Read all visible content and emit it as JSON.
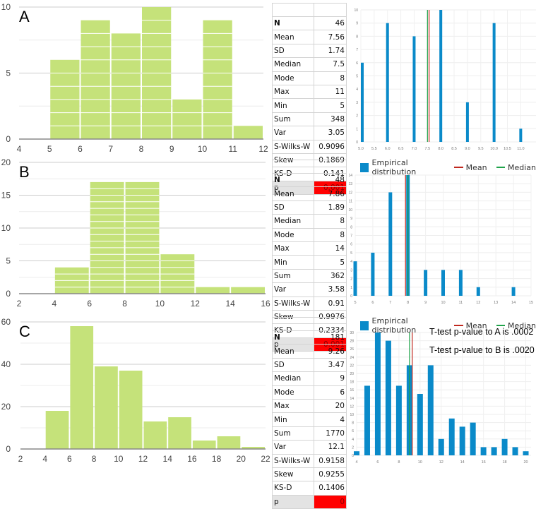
{
  "colors": {
    "histogram_fill": "#c5e27a",
    "empirical_bar": "#0a8ac9",
    "mean_line": "#c0281f",
    "median_line": "#1fa34a",
    "p_cell": "#ff0000",
    "p_text": "#8b0000"
  },
  "legend": {
    "empirical": "Empirical distribution",
    "mean": "Mean",
    "median": "Median"
  },
  "notes": {
    "ttest_a": "T-test p-value to A is .0002",
    "ttest_b": "T-test p-value to B is .0020"
  },
  "chart_data": [
    {
      "id": "A-histogram",
      "type": "bar",
      "title": "A",
      "bin_edges": [
        4,
        5,
        6,
        7,
        8,
        9,
        10,
        11,
        12
      ],
      "values": [
        0,
        6,
        9,
        8,
        10,
        3,
        9,
        1
      ],
      "xlim": [
        4,
        12
      ],
      "ylim": [
        0,
        10
      ],
      "xticks": [
        4,
        5,
        6,
        7,
        8,
        9,
        10,
        11,
        12
      ],
      "yticks": [
        0,
        5,
        10
      ],
      "grid": true
    },
    {
      "id": "A-empirical",
      "type": "bar",
      "x": [
        5,
        6,
        7,
        8,
        9,
        10,
        11
      ],
      "values": [
        6,
        9,
        8,
        10,
        3,
        9,
        1
      ],
      "mean": 7.56,
      "median": 7.5,
      "xlim": [
        5.0,
        11.6
      ],
      "ylim": [
        0,
        10
      ],
      "xticks": [
        "5.0",
        "5.5",
        "6.0",
        "6.5",
        "7.0",
        "7.5",
        "8.0",
        "8.5",
        "9.0",
        "9.5",
        "10.0",
        "10.5",
        "11.0"
      ],
      "yticks": [
        0,
        1,
        2,
        3,
        4,
        5,
        6,
        7,
        8,
        9,
        10
      ],
      "grid": true
    },
    {
      "id": "B-histogram",
      "type": "bar",
      "title": "B",
      "bin_edges": [
        2,
        4,
        6,
        8,
        10,
        12,
        14,
        16
      ],
      "values": [
        0,
        4,
        17,
        17,
        6,
        1,
        1
      ],
      "xlim": [
        2,
        16
      ],
      "ylim": [
        0,
        20
      ],
      "xticks": [
        2,
        4,
        6,
        8,
        10,
        12,
        14,
        16
      ],
      "yticks": [
        0,
        5,
        10,
        15,
        20
      ],
      "grid": true
    },
    {
      "id": "B-empirical",
      "type": "bar",
      "legend": "top",
      "x": [
        5,
        6,
        7,
        8,
        9,
        10,
        11,
        12,
        14
      ],
      "values": [
        4,
        5,
        12,
        14,
        3,
        3,
        3,
        1,
        1
      ],
      "mean": 7.86,
      "median": 8,
      "xlim": [
        5,
        15
      ],
      "ylim": [
        0,
        14
      ],
      "xticks": [
        5,
        6,
        7,
        8,
        9,
        10,
        11,
        12,
        13,
        14,
        15
      ],
      "yticks": [
        0,
        1,
        2,
        3,
        4,
        5,
        6,
        7,
        8,
        9,
        10,
        11,
        12,
        13,
        14
      ],
      "grid": true
    },
    {
      "id": "C-histogram",
      "type": "bar",
      "title": "C",
      "bin_edges": [
        2,
        4,
        6,
        8,
        10,
        12,
        14,
        16,
        18,
        20,
        22
      ],
      "values": [
        0,
        18,
        58,
        39,
        37,
        13,
        15,
        4,
        6,
        1
      ],
      "xlim": [
        2,
        22
      ],
      "ylim": [
        0,
        60
      ],
      "xticks": [
        2,
        4,
        6,
        8,
        10,
        12,
        14,
        16,
        18,
        20,
        22
      ],
      "yticks": [
        0,
        20,
        40,
        60
      ],
      "grid": true
    },
    {
      "id": "C-empirical",
      "type": "bar",
      "legend": "top",
      "x": [
        4,
        5,
        6,
        7,
        8,
        9,
        10,
        11,
        12,
        13,
        14,
        15,
        16,
        17,
        18,
        19,
        20
      ],
      "values": [
        1,
        17,
        30,
        28,
        17,
        22,
        15,
        22,
        4,
        9,
        7,
        8,
        2,
        2,
        4,
        2,
        1
      ],
      "mean": 9.26,
      "median": 9,
      "xlim": [
        4,
        20.5
      ],
      "ylim": [
        0,
        30
      ],
      "xticks": [
        4,
        6,
        8,
        10,
        12,
        14,
        16,
        18,
        20
      ],
      "yticks": [
        0,
        2,
        4,
        6,
        8,
        10,
        12,
        14,
        16,
        18,
        20,
        22,
        24,
        26,
        28,
        30
      ],
      "grid": true
    }
  ],
  "stats": [
    {
      "panel": "A",
      "rows": [
        {
          "key": "N",
          "value": "46"
        },
        {
          "key": "Mean",
          "value": "7.56"
        },
        {
          "key": "SD",
          "value": "1.74"
        },
        {
          "key": "Median",
          "value": "7.5"
        },
        {
          "key": "Mode",
          "value": "8"
        },
        {
          "key": "Max",
          "value": "11"
        },
        {
          "key": "Min",
          "value": "5"
        },
        {
          "key": "Sum",
          "value": "348"
        },
        {
          "key": "Var",
          "value": "3.05"
        },
        {
          "key": "S-Wilks-W",
          "value": "0.9096"
        },
        {
          "key": "Skew",
          "value": "0.1869"
        },
        {
          "key": "KS-D",
          "value": "0.141"
        },
        {
          "key": "p",
          "value": "0.001"
        }
      ]
    },
    {
      "panel": "B",
      "rows": [
        {
          "key": "N",
          "value": "48"
        },
        {
          "key": "Mean",
          "value": "7.86"
        },
        {
          "key": "SD",
          "value": "1.89"
        },
        {
          "key": "Median",
          "value": "8"
        },
        {
          "key": "Mode",
          "value": "8"
        },
        {
          "key": "Max",
          "value": "14"
        },
        {
          "key": "Min",
          "value": "5"
        },
        {
          "key": "Sum",
          "value": "362"
        },
        {
          "key": "Var",
          "value": "3.58"
        },
        {
          "key": "S-Wilks-W",
          "value": "0.91"
        },
        {
          "key": "Skew",
          "value": "0.9976"
        },
        {
          "key": "KS-D",
          "value": "0.2334"
        },
        {
          "key": "p",
          "value": "0.001"
        }
      ]
    },
    {
      "panel": "C",
      "rows": [
        {
          "key": "N",
          "value": "181"
        },
        {
          "key": "Mean",
          "value": "9.26"
        },
        {
          "key": "SD",
          "value": "3.47"
        },
        {
          "key": "Median",
          "value": "9"
        },
        {
          "key": "Mode",
          "value": "6"
        },
        {
          "key": "Max",
          "value": "20"
        },
        {
          "key": "Min",
          "value": "4"
        },
        {
          "key": "Sum",
          "value": "1770"
        },
        {
          "key": "Var",
          "value": "12.1"
        },
        {
          "key": "S-Wilks-W",
          "value": "0.9158"
        },
        {
          "key": "Skew",
          "value": "0.9255"
        },
        {
          "key": "KS-D",
          "value": "0.1406"
        },
        {
          "key": "p",
          "value": "0"
        }
      ]
    }
  ]
}
